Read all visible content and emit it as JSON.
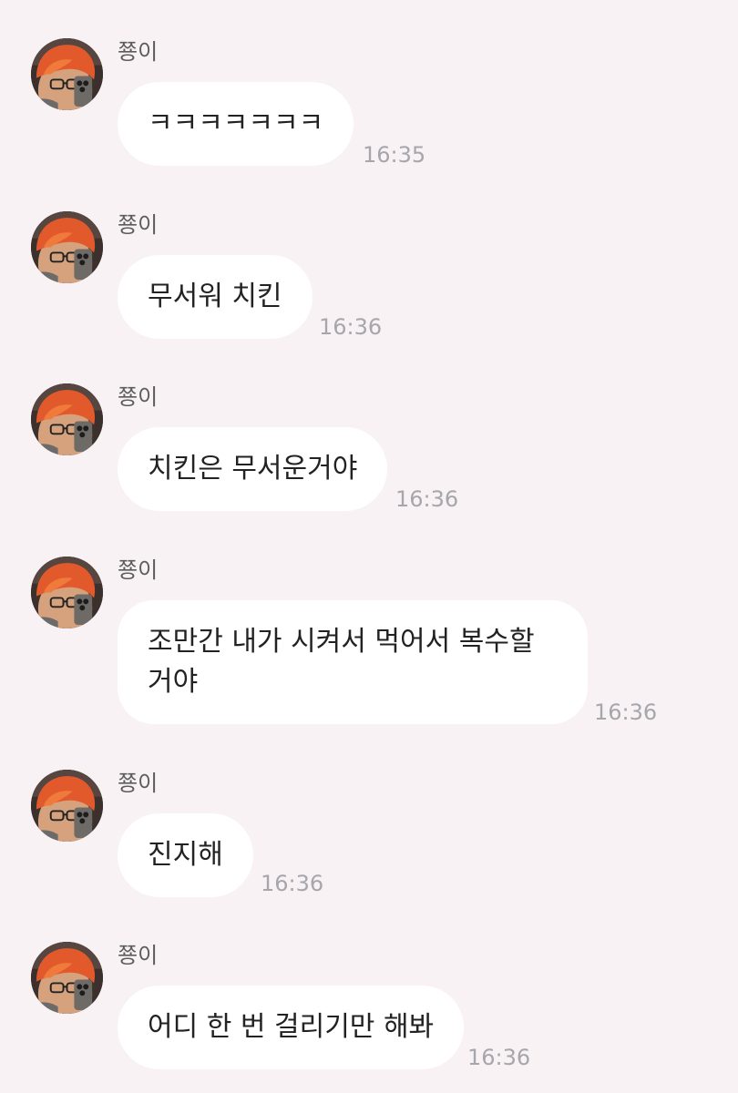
{
  "colors": {
    "background": "#f8f2f5",
    "bubble": "#ffffff",
    "timestamp": "#a6a6ab",
    "sender_name": "#5c5c5c"
  },
  "messages": [
    {
      "sender": "쭁이",
      "text": "ㅋㅋㅋㅋㅋㅋㅋ",
      "time": "16:35",
      "avatar_icon": "profile-avatar-icon"
    },
    {
      "sender": "쭁이",
      "text": "무서워 치킨",
      "time": "16:36",
      "avatar_icon": "profile-avatar-icon"
    },
    {
      "sender": "쭁이",
      "text": "치킨은 무서운거야",
      "time": "16:36",
      "avatar_icon": "profile-avatar-icon"
    },
    {
      "sender": "쭁이",
      "text": "조만간 내가 시켜서 먹어서 복수할거야",
      "time": "16:36",
      "avatar_icon": "profile-avatar-icon"
    },
    {
      "sender": "쭁이",
      "text": "진지해",
      "time": "16:36",
      "avatar_icon": "profile-avatar-icon"
    },
    {
      "sender": "쭁이",
      "text": "어디 한 번 걸리기만 해봐",
      "time": "16:36",
      "avatar_icon": "profile-avatar-icon"
    }
  ]
}
